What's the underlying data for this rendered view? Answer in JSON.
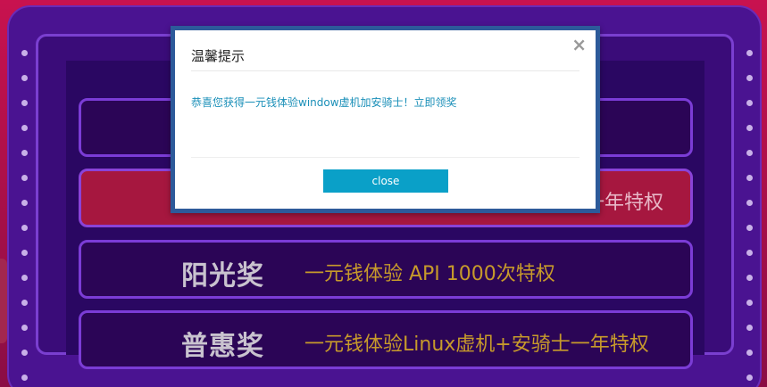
{
  "modal": {
    "title": "温馨提示",
    "close_icon": "×",
    "message": "恭喜您获得一元钱体验window虚机加安骑士！立即领奖",
    "button_label": "close"
  },
  "prizes": [
    {
      "title": "",
      "desc": ""
    },
    {
      "title": "",
      "desc": "一年特权"
    },
    {
      "title": "阳光奖",
      "desc": "一元钱体验 API 1000次特权"
    },
    {
      "title": "普惠奖",
      "desc": "一元钱体验Linux虚机+安骑士一年特权"
    }
  ],
  "colors": {
    "background": "#c8124f",
    "frame": "#4a1391",
    "row_highlight": "#a6173f",
    "prize_text": "#c79a2b",
    "modal_button": "#0aa0c8",
    "modal_message": "#1a8fb8"
  }
}
